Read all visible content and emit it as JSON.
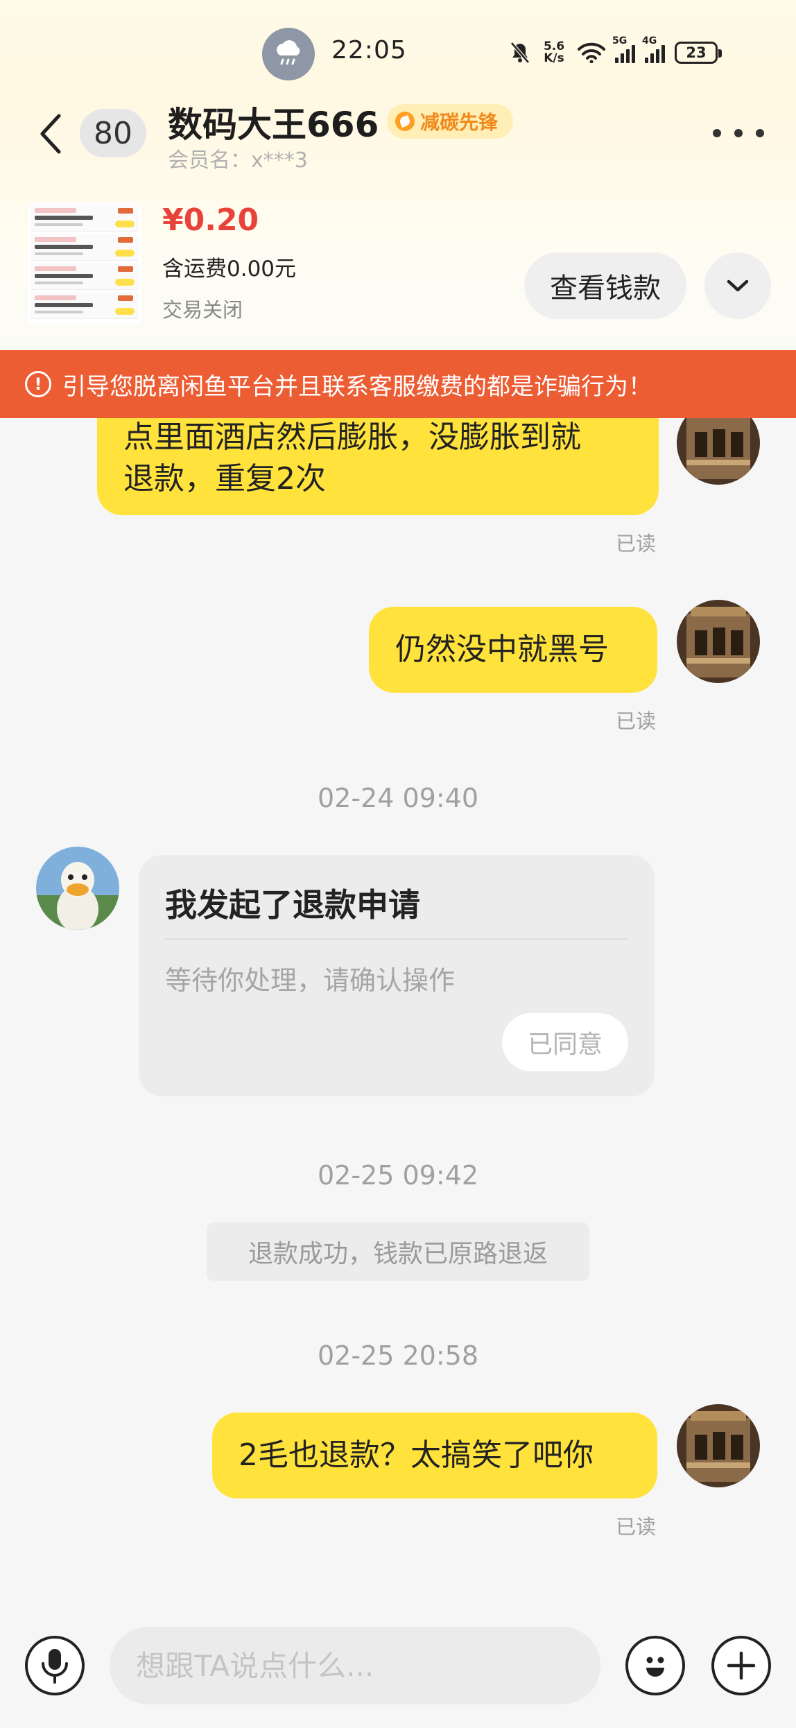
{
  "status_bar": {
    "time": "22:05",
    "net_speed_value": "5.6",
    "net_speed_unit": "K/s",
    "signal1_tag": "5G",
    "signal2_tag": "4G",
    "battery": "23",
    "weather_icon": "cloud-rain-icon"
  },
  "header": {
    "unread_count": "80",
    "title": "数码大王666",
    "badge": "减碳先锋",
    "member_name": "会员名：x***3"
  },
  "product": {
    "price": "¥0.20",
    "shipping": "含运费0.00元",
    "status": "交易关闭",
    "view_money_label": "查看钱款"
  },
  "warning": {
    "text": "引导您脱离闲鱼平台并且联系客服缴费的都是诈骗行为！"
  },
  "messages": {
    "msg1_line1": "点里面酒店然后膨胀，没膨胀到就",
    "msg1_line2": "退款，重复2次",
    "msg1_read": "已读",
    "msg2": "仍然没中就黑号",
    "msg2_read": "已读",
    "time1": "02-24 09:40",
    "refund_title": "我发起了退款申请",
    "refund_sub": "等待你处理，请确认操作",
    "refund_button": "已同意",
    "time2": "02-25 09:42",
    "system_msg": "退款成功，钱款已原路退返",
    "time3": "02-25 20:58",
    "msg3": "2毛也退款？太搞笑了吧你",
    "msg3_read": "已读"
  },
  "input": {
    "placeholder": "想跟TA说点什么..."
  },
  "colors": {
    "accent_yellow": "#ffe33c",
    "warning_orange": "#ec5d34",
    "price_red": "#e8433b"
  }
}
